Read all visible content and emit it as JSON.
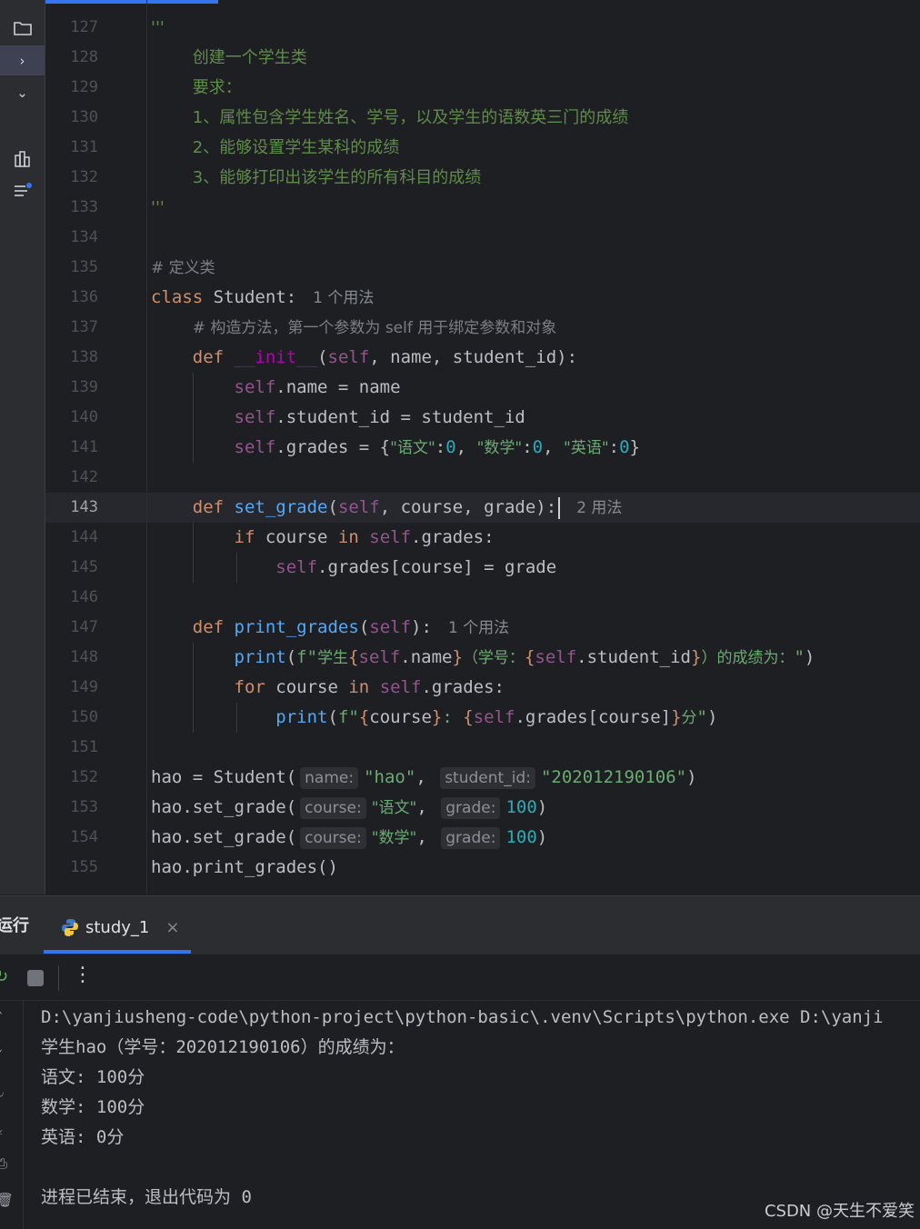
{
  "editor": {
    "current_line": "143",
    "line_numbers": [
      "127",
      "128",
      "129",
      "130",
      "131",
      "132",
      "133",
      "134",
      "135",
      "136",
      "137",
      "138",
      "139",
      "140",
      "141",
      "142",
      "143",
      "144",
      "145",
      "146",
      "147",
      "148",
      "149",
      "150",
      "151",
      "152",
      "153",
      "154",
      "155"
    ],
    "usages": {
      "class_student": "1 个用法",
      "set_grade": "2 用法",
      "print_grades": "1 个用法"
    },
    "hints": {
      "name": "name:",
      "student_id": "student_id:",
      "course": "course:",
      "grade": "grade:"
    },
    "doc": {
      "quote": "'''",
      "l1": "创建一个学生类",
      "l2": "要求：",
      "l3": "1、属性包含学生姓名、学号，以及学生的语数英三门的成绩",
      "l4": "2、能够设置学生某科的成绩",
      "l5": "3、能够打印出该学生的所有科目的成绩"
    },
    "comments": {
      "define_class": "# 定义类",
      "constructor": "# 构造方法，第一个参数为 self 用于绑定参数和对象"
    },
    "strings": {
      "yuwen": "\"语文\"",
      "shuxue": "\"数学\"",
      "yingyu": "\"英语\"",
      "hao": "\"hao\"",
      "sid": "\"202012190106\"",
      "stu_prefix": "学生",
      "paren_open": "（学号：",
      "paren_close": "）的成绩为：",
      "colon": ": ",
      "fen": "分"
    }
  },
  "run_panel": {
    "title": "运行",
    "tab_label": "study_1",
    "output": [
      "D:\\yanjiusheng-code\\python-project\\python-basic\\.venv\\Scripts\\python.exe D:\\yanji",
      "学生hao（学号：202012190106）的成绩为：",
      "语文: 100分",
      "数学: 100分",
      "英语: 0分",
      "",
      "进程已结束，退出代码为 0"
    ]
  },
  "watermark": "CSDN @天生不爱笑",
  "colors": {
    "keyword": "#cf8e6d",
    "function": "#56a8f5",
    "string": "#6aab73",
    "number": "#2aacb8",
    "self": "#94558d",
    "magic": "#b200b2",
    "accent": "#3574f0"
  }
}
